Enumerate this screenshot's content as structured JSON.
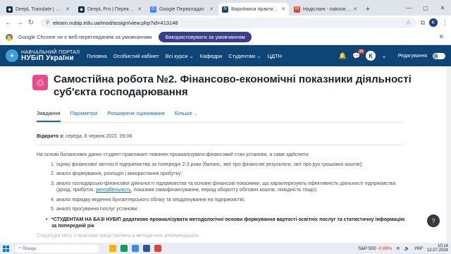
{
  "browser": {
    "tabs": [
      {
        "title": "DeepL Translate | Найточні",
        "favicon_color": "#0f2b46",
        "favicon_glyph": "◆",
        "active": false
      },
      {
        "title": "DeepL Pro | Перекладай те",
        "favicon_color": "#0f2b46",
        "favicon_glyph": "◆",
        "active": false
      },
      {
        "title": "Google Перекладач",
        "favicon_color": "#4285f4",
        "favicon_glyph": "G",
        "active": false
      },
      {
        "title": "Виробнича практика (Біб",
        "favicon_color": "#0d4576",
        "favicon_glyph": "N",
        "active": true
      },
      {
        "title": "Надіслані - nakonechna@",
        "favicon_color": "#ea4335",
        "favicon_glyph": "M",
        "active": false
      }
    ],
    "url": "elearn.nubip.edu.ua/mod/assign/view.php?id=413148",
    "profile_initial": "K"
  },
  "infobar": {
    "message": "Google Chrome не є веб-переглядачем за умовчанням",
    "button_label": "Використовувати за умовчанням"
  },
  "moodle": {
    "logo_top": "НАВЧАЛЬНИЙ ПОРТАЛ",
    "logo_bottom": "НУБіП України",
    "menu": [
      "Головна",
      "Особистий кабінет",
      "Всі курси ⌄",
      "Кафедри",
      "Студентам ⌄",
      "ЦДТН"
    ],
    "notification_count": "10",
    "user_initial": "K",
    "edit_mode_label": "Редагування"
  },
  "page": {
    "title": "Самостійна робота №2. Фінансово-економічні показники діяльності суб'єкта господарювання",
    "tabs": [
      {
        "label": "Завдання",
        "active": true
      },
      {
        "label": "Параметри",
        "active": false
      },
      {
        "label": "Розширене оцінювання",
        "active": false
      },
      {
        "label": "Більше",
        "active": false
      }
    ],
    "opened_label": "Відкрито з:",
    "opened_value": "середа, 8 червня 2022, 09:08",
    "intro": "На основі балансових даних студент-практикант повинен проаналізувати фінансовий стан установи, а саме здійснити:",
    "items": [
      {
        "num": "1.",
        "text": "оцінку фінансової звітності підприємства за попередні 2-3 роки (баланс, звіт про фінансові результати, звіт про рух грошових коштів);"
      },
      {
        "num": "2.",
        "text": " аналіз формування, розподіл і використання прибутку;"
      },
      {
        "num": "3.",
        "text_before": "аналіз господарсько-фінансової діяльності підприємства та основні фінансові показники, що характеризують ефективність діяльності підприємства (дохід, прибуток, ",
        "link": "рентабельність",
        "text_after": ", показник самофінансування, період оборотту обігових коштів, ліквідність тощо);"
      },
      {
        "num": "4.",
        "text": "аналіз порядку ведення бухгалтерського обліку та оподаткування на підприємстві;"
      },
      {
        "num": "5.",
        "text": "аналіз просування послуг установи."
      }
    ],
    "notice": "*СТУДЕНТАМ НА БАЗІ НУБІП додатково проаналізувати методологічні основи формування вартості освітніх послуг та статистичну інформацію за попередній рік",
    "faded_text": "Структура звіту з практики представлена в методичних рекомендаціях.",
    "help_label": "?"
  },
  "taskbar": {
    "search_placeholder": "Пошук",
    "stock_name": "S&P 500",
    "stock_change": "-0.88%",
    "language": "УКР",
    "time": "10:14",
    "date": "12.07.2024"
  }
}
